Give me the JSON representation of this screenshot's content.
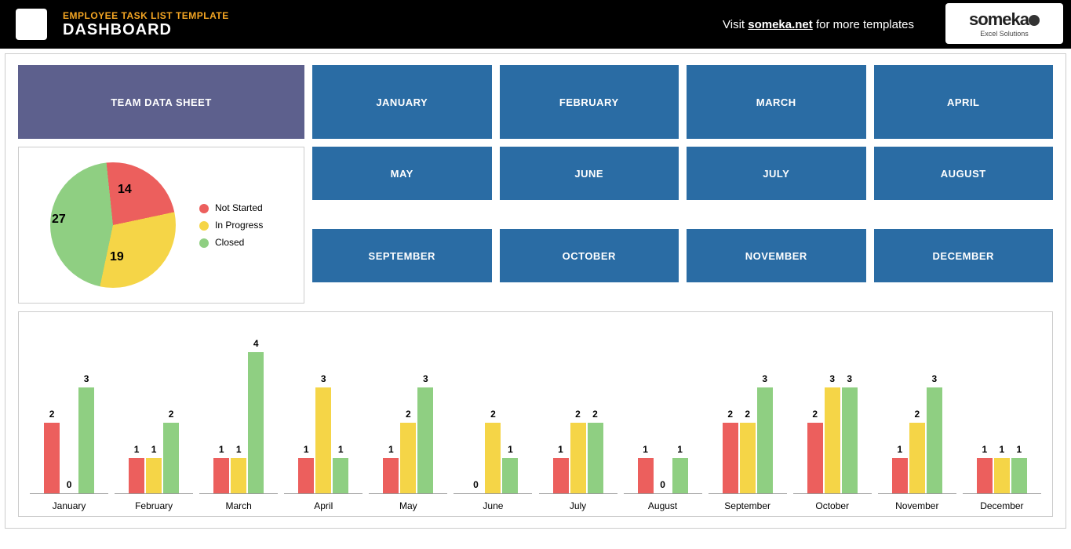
{
  "header": {
    "title_small": "EMPLOYEE TASK LIST TEMPLATE",
    "title_big": "DASHBOARD",
    "link_prefix": "Visit ",
    "link_site": "someka.net",
    "link_suffix": " for more templates",
    "logo_main": "someka",
    "logo_sub": "Excel Solutions"
  },
  "buttons": {
    "team": "TEAM DATA SHEET",
    "months": [
      "JANUARY",
      "FEBRUARY",
      "MARCH",
      "APRIL",
      "MAY",
      "JUNE",
      "JULY",
      "AUGUST",
      "SEPTEMBER",
      "OCTOBER",
      "NOVEMBER",
      "DECEMBER"
    ]
  },
  "legend": {
    "not_started": "Not Started",
    "in_progress": "In Progress",
    "closed": "Closed"
  },
  "colors": {
    "red": "#ec5f5d",
    "yellow": "#f5d547",
    "green": "#8fcf82",
    "purple": "#5d608d",
    "blue": "#2a6ca4"
  },
  "chart_data": [
    {
      "type": "pie",
      "title": "",
      "series": [
        {
          "name": "Not Started",
          "value": 14,
          "color": "#ec5f5d"
        },
        {
          "name": "In Progress",
          "value": 19,
          "color": "#f5d547"
        },
        {
          "name": "Closed",
          "value": 27,
          "color": "#8fcf82"
        }
      ]
    },
    {
      "type": "bar",
      "categories": [
        "January",
        "February",
        "March",
        "April",
        "May",
        "June",
        "July",
        "August",
        "September",
        "October",
        "November",
        "December"
      ],
      "series": [
        {
          "name": "Not Started",
          "color": "#ec5f5d",
          "values": [
            2,
            1,
            1,
            1,
            1,
            0,
            1,
            1,
            2,
            2,
            1,
            1
          ]
        },
        {
          "name": "In Progress",
          "color": "#f5d547",
          "values": [
            0,
            1,
            1,
            3,
            2,
            2,
            2,
            0,
            2,
            3,
            2,
            1
          ]
        },
        {
          "name": "Closed",
          "color": "#8fcf82",
          "values": [
            3,
            2,
            4,
            1,
            3,
            1,
            2,
            1,
            3,
            3,
            3,
            1
          ]
        }
      ],
      "ylim": [
        0,
        4
      ]
    }
  ]
}
